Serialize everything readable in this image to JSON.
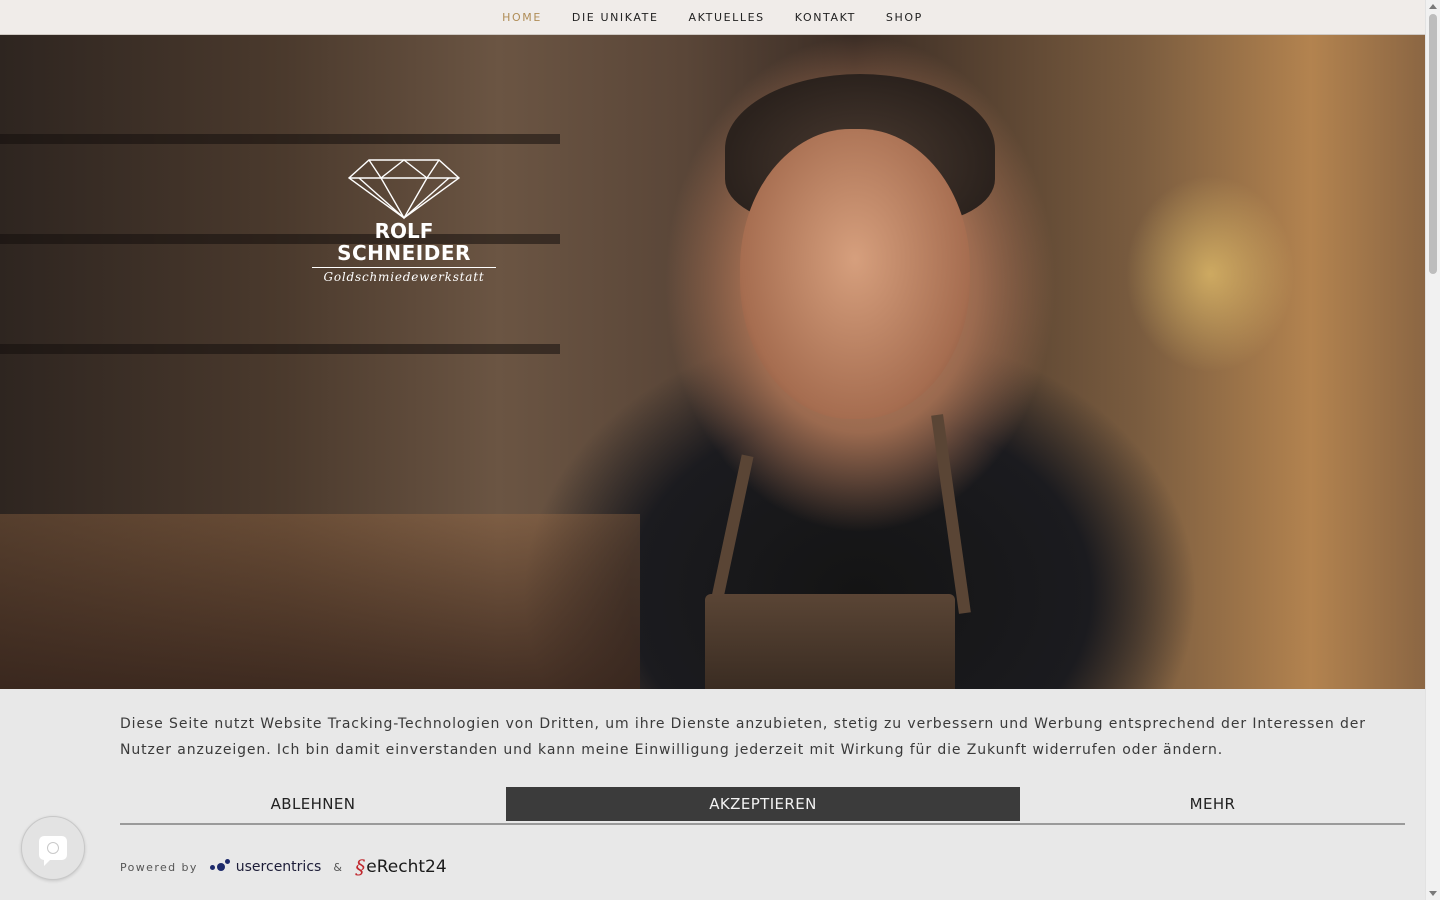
{
  "nav": {
    "items": [
      {
        "label": "HOME",
        "active": true
      },
      {
        "label": "DIE UNIKATE",
        "active": false
      },
      {
        "label": "AKTUELLES",
        "active": false
      },
      {
        "label": "KONTAKT",
        "active": false
      },
      {
        "label": "SHOP",
        "active": false
      }
    ],
    "active_color": "#b08d57"
  },
  "logo": {
    "line1": "ROLF",
    "line2": "SCHNEIDER",
    "line3": "Goldschmiedewerkstatt",
    "icon": "diamond-icon"
  },
  "hero": {
    "image": "goldsmith-portrait"
  },
  "consent": {
    "text": "Diese Seite nutzt Website Tracking-Technologien von Dritten, um ihre Dienste anzubieten, stetig zu verbessern und Werbung entsprechend der Interessen der Nutzer anzuzeigen. Ich bin damit einverstanden und kann meine Einwilligung jederzeit mit Wirkung für die Zukunft widerrufen oder ändern.",
    "decline_label": "ABLEHNEN",
    "accept_label": "AKZEPTIEREN",
    "more_label": "MEHR",
    "powered_by": "Powered by",
    "brand1": "usercentrics",
    "ampersand": "&",
    "brand2": "eRecht24",
    "brand2_symbol": "§"
  },
  "privacy_button": {
    "icon": "fingerprint-chat-icon"
  },
  "colors": {
    "accept_bg": "#3b3b3b",
    "consent_bg": "#e8e8e8",
    "erecht_red": "#c0272d",
    "uc_blue": "#1d2a6b"
  }
}
